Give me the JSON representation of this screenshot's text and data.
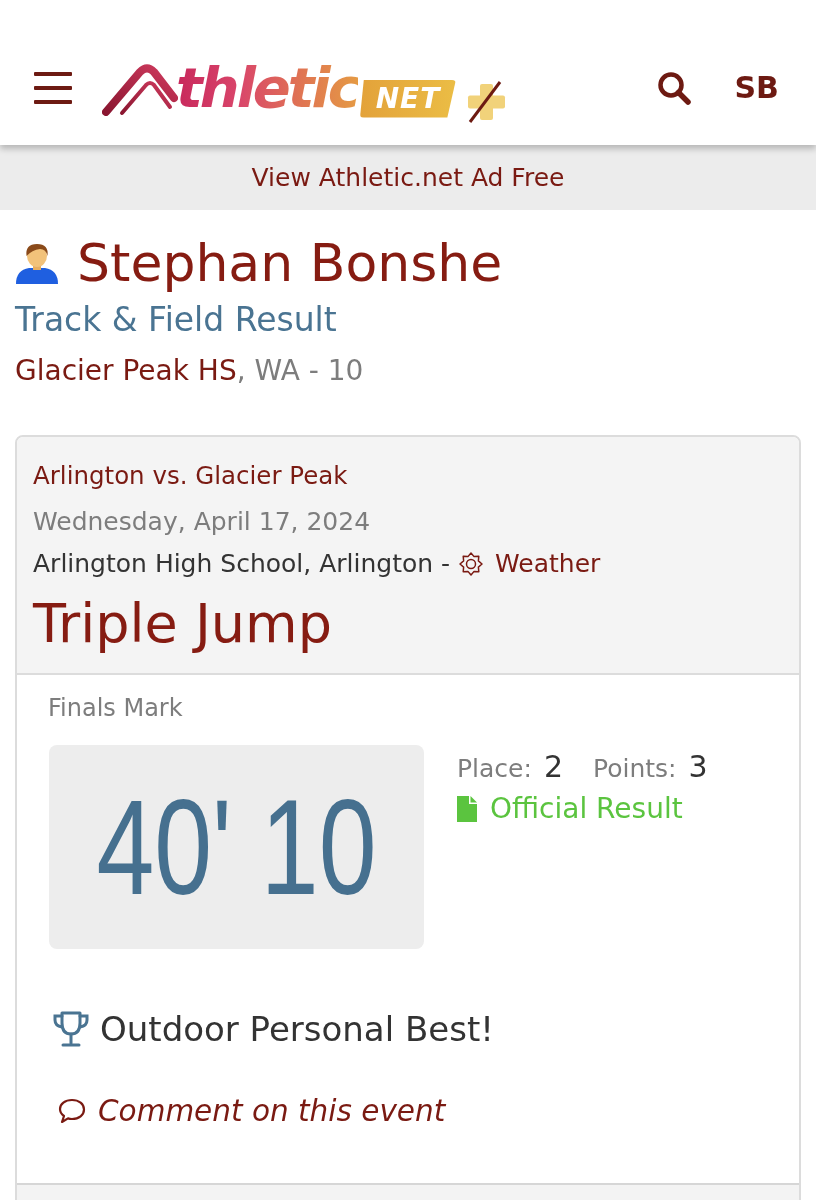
{
  "header": {
    "logo": {
      "wordmark": "thletic",
      "badge": "NET"
    },
    "account_initials": "SB"
  },
  "ad_banner": {
    "link": "View Athletic.net Ad Free"
  },
  "athlete": {
    "name": "Stephan Bonshe",
    "subtitle": "Track & Field Result",
    "school": "Glacier Peak HS",
    "details": ", WA - 10"
  },
  "meet": {
    "title": "Arlington vs. Glacier Peak",
    "date": "Wednesday, April 17, 2024",
    "location": "Arlington High School, Arlington -",
    "weather_link": "Weather",
    "event": "Triple Jump"
  },
  "result": {
    "label": "Finals Mark",
    "mark": "40' 10",
    "place_label": "Place:",
    "place": "2",
    "points_label": "Points:",
    "points": "3",
    "official_link": "Official Result",
    "achievement": "Outdoor Personal Best!",
    "comment_link": "Comment on this event"
  }
}
